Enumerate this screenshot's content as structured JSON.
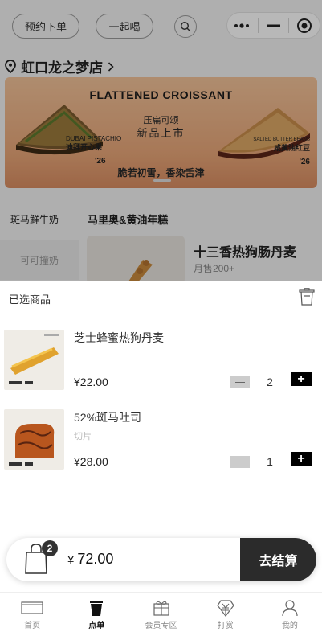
{
  "header": {
    "preorder_label": "预约下单",
    "together_label": "一起喝"
  },
  "store": {
    "name": "虹口龙之梦店"
  },
  "banner": {
    "title": "FLATTENED CROISSANT",
    "subtitle_line1": "压扁可颂",
    "subtitle_line2": "新品上市",
    "tagline": "脆若初雪，香染舌津",
    "left_en": "DUBAI PISTACHIO",
    "left_cn": "迪拜开心果",
    "left_year": "'26",
    "right_en": "SALTED BUTTER BEANS",
    "right_cn": "咸黄油红豆",
    "right_year": "'26"
  },
  "categories": {
    "tab1": "斑马鲜牛奶",
    "tab2": "马里奥&黄油年糕",
    "side_item": "可可撞奶"
  },
  "featured_product": {
    "name": "十三香热狗肠丹麦",
    "sales": "月售200+"
  },
  "cart": {
    "title": "已选商品",
    "items": [
      {
        "name": "芝士蜂蜜热狗丹麦",
        "spec": "",
        "price": "¥22.00",
        "qty": "2"
      },
      {
        "name": "52%斑马吐司",
        "spec": "切片",
        "price": "¥28.00",
        "qty": "1"
      }
    ],
    "count": "2",
    "currency": "¥",
    "total": "72.00",
    "checkout_label": "去结算"
  },
  "tabbar": {
    "items": [
      {
        "label": "首页",
        "icon": "home-icon"
      },
      {
        "label": "点单",
        "icon": "cup-icon"
      },
      {
        "label": "会员专区",
        "icon": "gift-icon"
      },
      {
        "label": "打赏",
        "icon": "yuan-icon"
      },
      {
        "label": "我的",
        "icon": "person-icon"
      }
    ],
    "active_index": 1
  },
  "colors": {
    "accent": "#2b2b2b",
    "banner": "#e8a678",
    "overlay": "rgba(0,0,0,0.28)"
  }
}
